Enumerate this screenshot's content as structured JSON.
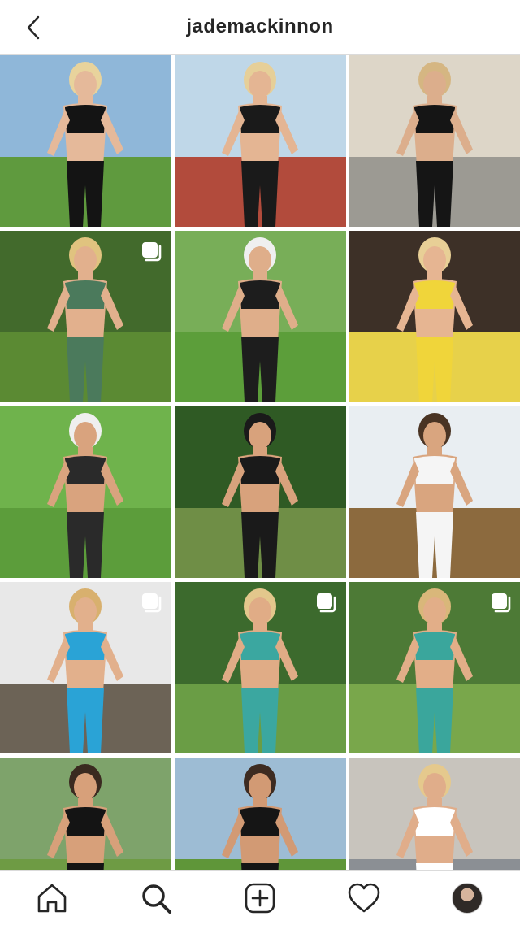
{
  "header": {
    "title": "jademackinnon",
    "back_icon": "chevron-left-icon"
  },
  "posts": [
    {
      "sky": "#8fb7d9",
      "ground": "#5f9a3e",
      "outfit": "#141414",
      "skin": "#e5b99a",
      "hair": "#e8d39c",
      "multi": false
    },
    {
      "sky": "#bfd7e8",
      "ground": "#b24b3c",
      "outfit": "#1a1a1a",
      "skin": "#e4b593",
      "hair": "#e6cf98",
      "multi": false
    },
    {
      "sky": "#ddd6c8",
      "ground": "#9c9a93",
      "outfit": "#151515",
      "skin": "#dcae8c",
      "hair": "#d5b682",
      "multi": false
    },
    {
      "sky": "#426a2c",
      "ground": "#5b8a33",
      "outfit": "#4b7a5c",
      "skin": "#e2b08d",
      "hair": "#e0c37f",
      "multi": true
    },
    {
      "sky": "#78ae58",
      "ground": "#5c9e3a",
      "outfit": "#1d1d1d",
      "skin": "#dfae8a",
      "hair": "#efefef",
      "multi": false
    },
    {
      "sky": "#3d3027",
      "ground": "#e7d14a",
      "outfit": "#f0d53a",
      "skin": "#e6b592",
      "hair": "#e8cf96",
      "multi": false
    },
    {
      "sky": "#6fb34c",
      "ground": "#5c9d3b",
      "outfit": "#2a2a2a",
      "skin": "#d9a37e",
      "hair": "#efefef",
      "multi": false
    },
    {
      "sky": "#2f5a24",
      "ground": "#6f8e46",
      "outfit": "#1a1a1a",
      "skin": "#d8a27c",
      "hair": "#1a1a1a",
      "multi": false
    },
    {
      "sky": "#e9eef2",
      "ground": "#8c6a3e",
      "outfit": "#f5f5f5",
      "skin": "#d9a57f",
      "hair": "#4a3424",
      "multi": false
    },
    {
      "sky": "#e8e8e8",
      "ground": "#6c6356",
      "outfit": "#2aa3d6",
      "skin": "#e2b08c",
      "hair": "#d8b06e",
      "multi": true
    },
    {
      "sky": "#3c6a2d",
      "ground": "#6a9d45",
      "outfit": "#3ba7a0",
      "skin": "#e0ac86",
      "hair": "#e3c78c",
      "multi": true
    },
    {
      "sky": "#4d7a36",
      "ground": "#79a74b",
      "outfit": "#3aa69c",
      "skin": "#e2ae88",
      "hair": "#d9b77a",
      "multi": true
    },
    {
      "sky": "#7ea36b",
      "ground": "#6e9b44",
      "outfit": "#141414",
      "skin": "#d7a07a",
      "hair": "#3a2a20",
      "multi": false
    },
    {
      "sky": "#9dbcd4",
      "ground": "#5f9639",
      "outfit": "#151515",
      "skin": "#d29a74",
      "hair": "#3d2b21",
      "multi": false
    },
    {
      "sky": "#c8c4bd",
      "ground": "#8b8f94",
      "outfit": "#ffffff",
      "skin": "#e0ad8a",
      "hair": "#e5c98d",
      "multi": false
    }
  ],
  "tabs": [
    {
      "name": "home-icon"
    },
    {
      "name": "search-icon"
    },
    {
      "name": "new-post-icon"
    },
    {
      "name": "activity-heart-icon"
    },
    {
      "name": "profile-avatar"
    }
  ],
  "colors": {
    "text": "#262626",
    "divider": "#dbdbdb",
    "background": "#ffffff"
  }
}
